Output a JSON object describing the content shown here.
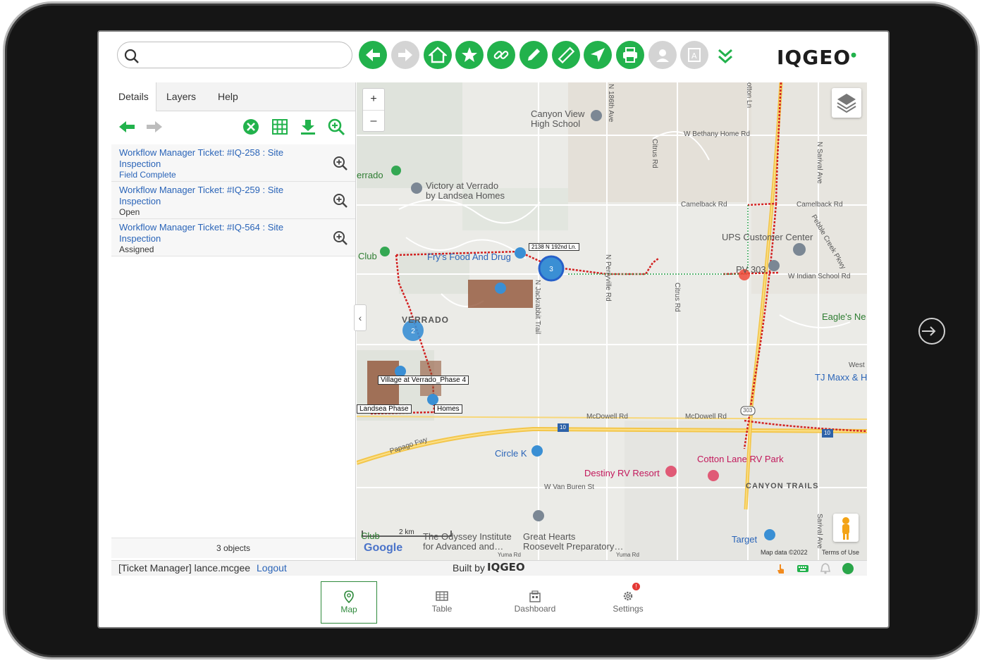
{
  "toolbar": {
    "search_placeholder": "",
    "buttons": [
      "back-icon",
      "forward-icon",
      "home-icon",
      "bookmark-star-icon",
      "link-icon",
      "edit-pencil-icon",
      "ruler-measure-icon",
      "locate-arrow-icon",
      "print-icon",
      "user-icon",
      "annotation-icon"
    ],
    "accent_color": "#22b24c",
    "logo_text": "IQGEO"
  },
  "panel": {
    "tabs": [
      "Details",
      "Layers",
      "Help"
    ],
    "results": [
      {
        "title": "Workflow Manager Ticket: #IQ-258 : Site Inspection",
        "status": "Field Complete"
      },
      {
        "title": "Workflow Manager Ticket: #IQ-259 : Site Inspection",
        "status": "Open"
      },
      {
        "title": "Workflow Manager Ticket: #IQ-564 : Site Inspection",
        "status": "Assigned"
      }
    ],
    "count_text": "3 objects"
  },
  "map": {
    "zoom_in": "+",
    "zoom_out": "–",
    "labels": {
      "canyon_view": "Canyon View\nHigh School",
      "verrado": "errado",
      "victory": "Victory at Verrado\nby Landsea Homes",
      "club_top": "Club",
      "frys": "Fry's Food And Drug",
      "addr_box": "2138 N 192nd Ln.",
      "verrado_big": "VERRADO",
      "village": "Village at Verrado_Phase 4",
      "homes": "Homes",
      "landsea": "Landsea Phase",
      "ups": "UPS Customer Center",
      "py303": "PV 303",
      "eagle": "Eagle's Ne",
      "tjmaxx": "TJ Maxx & H",
      "west": "West",
      "circle_k": "Circle K",
      "destiny": "Destiny RV Resort",
      "cotton": "Cotton Lane RV Park",
      "canyon_trails": "CANYON TRAILS",
      "odyssey": "The Odyssey Institute\nfor Advanced and…",
      "great_hearts": "Great Hearts\nRoosevelt Preparatory…",
      "target": "Target",
      "club_bottom": "Club",
      "roads": {
        "bethany": "W Bethany Home Rd",
        "camelback1": "Camelback Rd",
        "camelback2": "Camelback Rd",
        "indian": "W Indian School Rd",
        "mcdowell1": "McDowell Rd",
        "mcdowell2": "McDowell Rd",
        "vanburen": "W Van Buren St",
        "papago": "Papago Fwy",
        "citrus1": "Citrus Rd",
        "citrus2": "Citrus Rd",
        "perryville": "N Perryville Rd",
        "jackrabbit": "N Jackrabbit Trail",
        "sarival1": "N Sarival Ave",
        "sarival2": "Sarival Ave",
        "n186": "N 186th Ave",
        "cotton_ln": "otton Ln",
        "pebble": "Pebble Creek Pkwy",
        "yuma1": "Yuma Rd",
        "yuma2": "Yuma Rd"
      },
      "shields": {
        "i10a": "10",
        "i10b": "10",
        "r303a": "303"
      }
    },
    "clusters": [
      {
        "label": "3"
      },
      {
        "label": "2"
      }
    ],
    "scale": "2 km",
    "attribution": "Map data ©2022",
    "terms": "Terms of Use",
    "google": "Google"
  },
  "status": {
    "user_text": "[Ticket Manager] lance.mcgee",
    "logout": "Logout",
    "built_by": "Built by",
    "built_logo": "IQGEO"
  },
  "nav": {
    "items": [
      {
        "label": "Map",
        "icon": "map-pin-icon"
      },
      {
        "label": "Table",
        "icon": "table-icon"
      },
      {
        "label": "Dashboard",
        "icon": "dashboard-icon"
      },
      {
        "label": "Settings",
        "icon": "gear-icon"
      }
    ],
    "settings_badge": "!"
  }
}
